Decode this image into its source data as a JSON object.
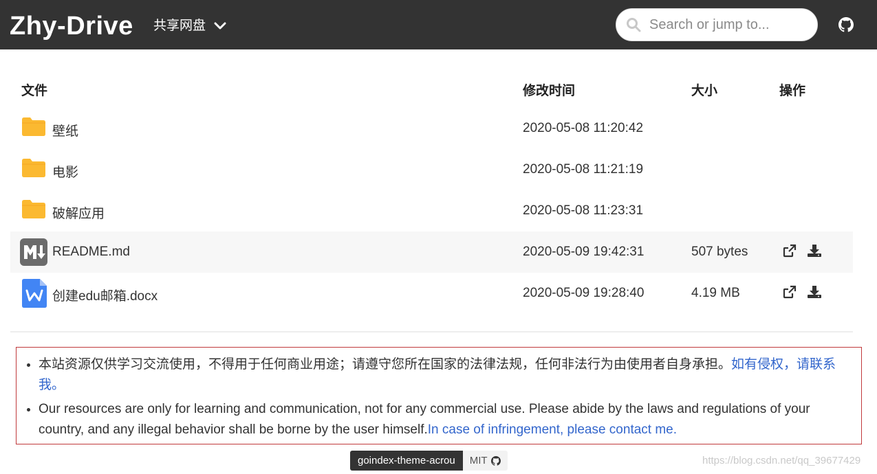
{
  "header": {
    "brand": "Zhy-Drive",
    "drive_label": "共享网盘",
    "search_placeholder": "Search or jump to..."
  },
  "table": {
    "columns": {
      "file": "文件",
      "modified": "修改时间",
      "size": "大小",
      "actions": "操作"
    },
    "rows": [
      {
        "icon": "folder-icon",
        "name": "壁纸",
        "modified": "2020-05-08 11:20:42",
        "size": ""
      },
      {
        "icon": "folder-icon",
        "name": "电影",
        "modified": "2020-05-08 11:21:19",
        "size": ""
      },
      {
        "icon": "folder-icon",
        "name": "破解应用",
        "modified": "2020-05-08 11:23:31",
        "size": ""
      },
      {
        "icon": "markdown-icon",
        "name": "README.md",
        "modified": "2020-05-09 19:42:31",
        "size": "507 bytes"
      },
      {
        "icon": "word-doc-icon",
        "name": "创建edu邮箱.docx",
        "modified": "2020-05-09 19:28:40",
        "size": "4.19 MB"
      }
    ]
  },
  "notice": {
    "zh_text": "本站资源仅供学习交流使用，不得用于任何商业用途；请遵守您所在国家的法律法规，任何非法行为由使用者自身承担。",
    "zh_link": "如有侵权，请联系我。",
    "en_text": "Our resources are only for learning and communication, not for any commercial use. Please abide by the laws and regulations of your country, and any illegal behavior shall be borne by the user himself.",
    "en_link": "In case of infringement, please contact me."
  },
  "footer": {
    "theme_badge": "goindex-theme-acrou",
    "license_badge": "MIT"
  },
  "watermark": "https://blog.csdn.net/qq_39677429",
  "colors": {
    "topbar": "#333333",
    "folder": "#FBB931",
    "link": "#3366cc",
    "notice_border": "#c0393b",
    "word_blue": "#4285f4"
  }
}
